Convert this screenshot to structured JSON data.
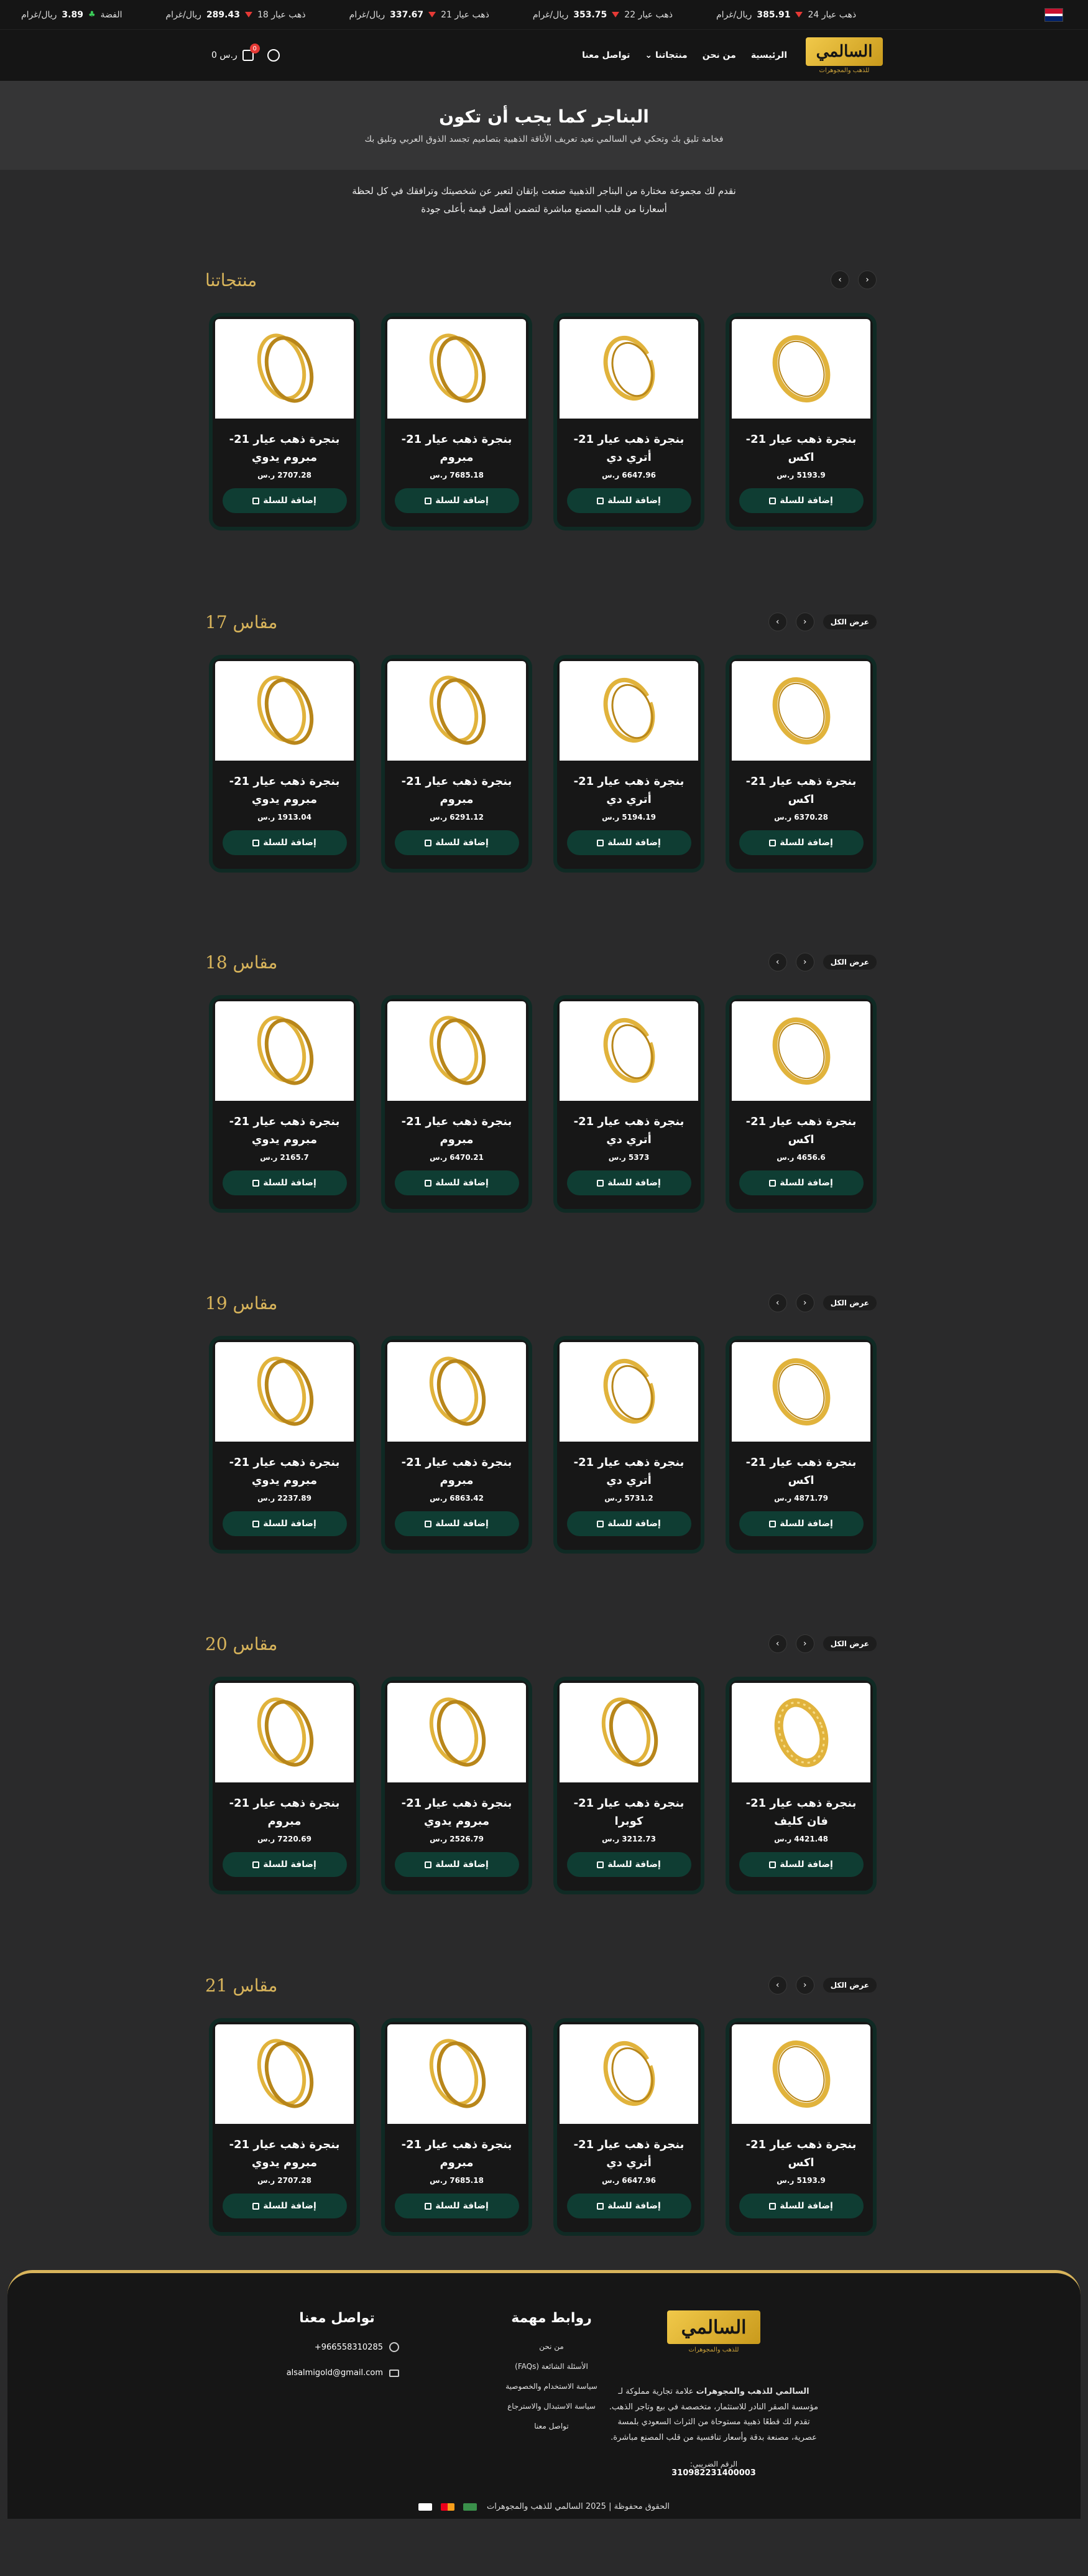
{
  "ticker": {
    "items": [
      {
        "label": "ذهب عيار 24",
        "value": "385.91",
        "unit": "ريال/غرام",
        "trend": "down"
      },
      {
        "label": "ذهب عيار 22",
        "value": "353.75",
        "unit": "ريال/غرام",
        "trend": "down"
      },
      {
        "label": "ذهب عيار 21",
        "value": "337.67",
        "unit": "ريال/غرام",
        "trend": "down"
      },
      {
        "label": "ذهب عيار 18",
        "value": "289.43",
        "unit": "ريال/غرام",
        "trend": "down"
      },
      {
        "label": "الفضة",
        "value": "3.89",
        "unit": "ريال/غرام",
        "trend": "up"
      }
    ]
  },
  "header": {
    "logo_text": "السالمي",
    "logo_sub": "للذهب والمجوهرات",
    "nav": [
      "الرئيسية",
      "من نحن",
      "منتجاتنا",
      "تواصل معنا"
    ],
    "cart_count": "0",
    "cart_total": "0 ر.س"
  },
  "hero": {
    "title": "البناجر كما يجب أن تكون",
    "subtitle": "فخامة تليق بك وتحكي في السالمي نعيد تعريف الأناقة الذهبية بتصاميم تجسد الذوق العربي وتليق بك"
  },
  "intro": {
    "line1": "نقدم لك مجموعة مختارة من البناجر الذهبية صنعت بإتقان لتعبر عن شخصيتك وترافقك في كل لحظة",
    "line2": "أسعارنا من قلب المصنع مباشرة لتضمن أفضل قيمة بأعلى جودة"
  },
  "add_label": "إضافة للسلة",
  "view_all": "عرض الكل",
  "sections": [
    {
      "title": "منتجاتنا",
      "show_view_all": false,
      "products": [
        {
          "name": "بنجرة ذهب عيار 21- اكس",
          "price": "5193.9 ر.س",
          "img": "ring-thin"
        },
        {
          "name": "بنجرة ذهب عيار 21- أتري دي",
          "price": "6647.96 ر.س",
          "img": "ring-open"
        },
        {
          "name": "بنجرة ذهب عيار 21- مبروم",
          "price": "7685.18 ر.س",
          "img": "ring-double"
        },
        {
          "name": "بنجرة ذهب عيار 21- مبروم يدوي",
          "price": "2707.28 ر.س",
          "img": "ring-double"
        }
      ]
    },
    {
      "title": "مقاس 17",
      "show_view_all": true,
      "products": [
        {
          "name": "بنجرة ذهب عيار 21- اكس",
          "price": "6370.28 ر.س",
          "img": "ring-thin"
        },
        {
          "name": "بنجرة ذهب عيار 21- أتري دي",
          "price": "5194.19 ر.س",
          "img": "ring-open"
        },
        {
          "name": "بنجرة ذهب عيار 21- مبروم",
          "price": "6291.12 ر.س",
          "img": "ring-double"
        },
        {
          "name": "بنجرة ذهب عيار 21- مبروم يدوي",
          "price": "1913.04 ر.س",
          "img": "ring-double"
        }
      ]
    },
    {
      "title": "مقاس 18",
      "show_view_all": true,
      "products": [
        {
          "name": "بنجرة ذهب عيار 21- اكس",
          "price": "4656.6 ر.س",
          "img": "ring-thin"
        },
        {
          "name": "بنجرة ذهب عيار 21- أتري دي",
          "price": "5373 ر.س",
          "img": "ring-open"
        },
        {
          "name": "بنجرة ذهب عيار 21- مبروم",
          "price": "6470.21 ر.س",
          "img": "ring-double"
        },
        {
          "name": "بنجرة ذهب عيار 21- مبروم يدوي",
          "price": "2165.7 ر.س",
          "img": "ring-double"
        }
      ]
    },
    {
      "title": "مقاس 19",
      "show_view_all": true,
      "products": [
        {
          "name": "بنجرة ذهب عيار 21- اكس",
          "price": "4871.79 ر.س",
          "img": "ring-thin"
        },
        {
          "name": "بنجرة ذهب عيار 21- أتري دي",
          "price": "5731.2 ر.س",
          "img": "ring-open"
        },
        {
          "name": "بنجرة ذهب عيار 21- مبروم",
          "price": "6863.42 ر.س",
          "img": "ring-double"
        },
        {
          "name": "بنجرة ذهب عيار 21- مبروم يدوي",
          "price": "2237.89 ر.س",
          "img": "ring-double"
        }
      ]
    },
    {
      "title": "مقاس 20",
      "show_view_all": true,
      "products": [
        {
          "name": "بنجرة ذهب عيار 21- فان كليف",
          "price": "4421.48 ر.س",
          "img": "ring-thick"
        },
        {
          "name": "بنجرة ذهب عيار 21- كوبرا",
          "price": "3212.73 ر.س",
          "img": "ring-double"
        },
        {
          "name": "بنجرة ذهب عيار 21- مبروم يدوي",
          "price": "2526.79 ر.س",
          "img": "ring-double"
        },
        {
          "name": "بنجرة ذهب عيار 21- مبروم",
          "price": "7220.69 ر.س",
          "img": "ring-double"
        }
      ]
    },
    {
      "title": "مقاس 21",
      "show_view_all": true,
      "products": [
        {
          "name": "بنجرة ذهب عيار 21- اكس",
          "price": "5193.9 ر.س",
          "img": "ring-thin"
        },
        {
          "name": "بنجرة ذهب عيار 21- أتري دي",
          "price": "6647.96 ر.س",
          "img": "ring-open"
        },
        {
          "name": "بنجرة ذهب عيار 21- مبروم",
          "price": "7685.18 ر.س",
          "img": "ring-double"
        },
        {
          "name": "بنجرة ذهب عيار 21- مبروم يدوي",
          "price": "2707.28 ر.س",
          "img": "ring-double"
        }
      ]
    }
  ],
  "footer": {
    "about_title": "السالمي للذهب والمجوهرات",
    "about_text": "علامة تجارية مملوكة لـ مؤسسة الصقر النادر للاستثمار، متخصصة في بيع وتاجر الذهب. تقدم لك قطعًا ذهبية مستوحاة من الثراث السعودي بلمسة عصرية، مصنعة بدقة وأسعار تنافسية من قلب المصنع مباشرة.",
    "reg_label": "الرقم الضريبي:",
    "reg_number": "310982231400003",
    "links_title": "روابط مهمة",
    "links": [
      "من نحن",
      "الأسئلة الشائعة (FAQs)",
      "سياسة الاستخدام والخصوصية",
      "سياسة الاستبدال والاسترجاع",
      "تواصل معنا"
    ],
    "contact_title": "تواصل معنا",
    "phone": "+966558310285",
    "email": "alsalmigold@gmail.com",
    "copyright": "الحقوق محفوظة | 2025 السالمي للذهب والمجوهرات"
  },
  "colors": {
    "accent": "#d8b45b",
    "button": "#0f3d33",
    "bg": "#2a2a2b"
  }
}
